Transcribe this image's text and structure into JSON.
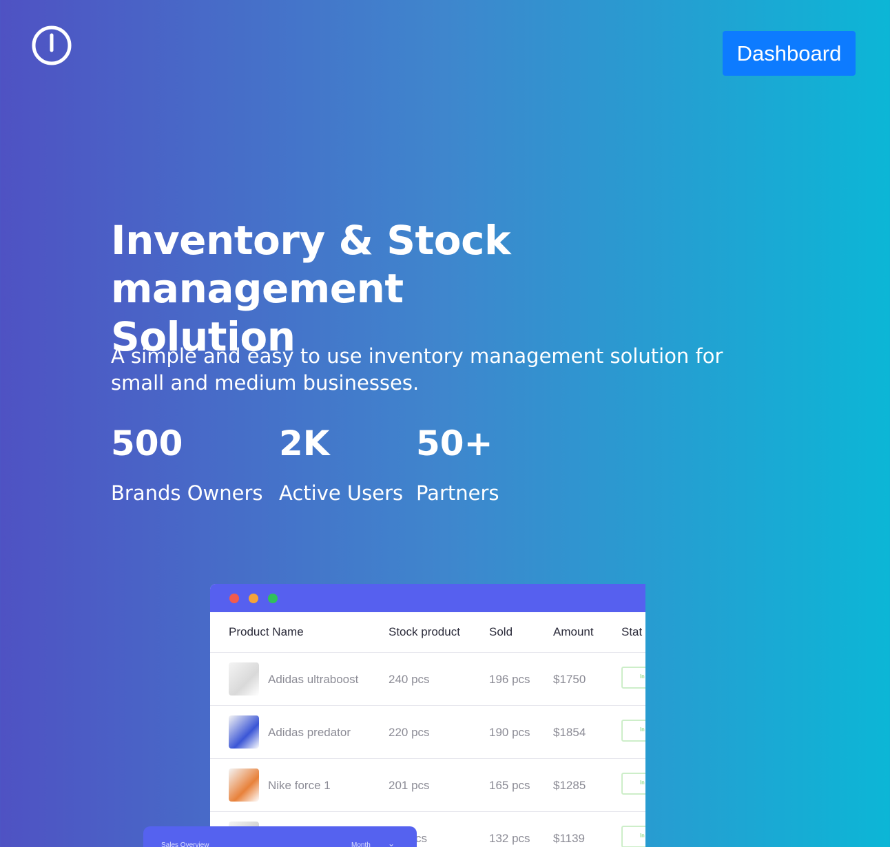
{
  "header": {
    "logo_icon": "power-icon",
    "dashboard_label": "Dashboard"
  },
  "hero": {
    "title_line1": "Inventory & Stock management",
    "title_line2": "Solution",
    "subtitle_line1": "A simple and easy to use inventory management solution for",
    "subtitle_line2": "small and medium businesses."
  },
  "stats": [
    {
      "value": "500",
      "label": "Brands Owners"
    },
    {
      "value": "2K",
      "label": "Active Users"
    },
    {
      "value": "50+",
      "label": "Partners"
    }
  ],
  "mockup": {
    "window_dots": [
      "#f15b4d",
      "#f5a33a",
      "#30c05a"
    ],
    "columns": [
      "Product Name",
      "Stock product",
      "Sold",
      "Amount",
      "Stat"
    ],
    "rows": [
      {
        "name": "Adidas ultraboost",
        "stock": "240 pcs",
        "sold": "196 pcs",
        "amount": "$1750",
        "status": "In",
        "thumb_color": "#d9d9d9"
      },
      {
        "name": "Adidas predator",
        "stock": "220 pcs",
        "sold": "190 pcs",
        "amount": "$1854",
        "status": "In",
        "thumb_color": "#3b56d6"
      },
      {
        "name": "Nike force 1",
        "stock": "201 pcs",
        "sold": "165 pcs",
        "amount": "$1285",
        "status": "In",
        "thumb_color": "#e8813a"
      },
      {
        "name": "",
        "stock": "cs",
        "sold": "132 pcs",
        "amount": "$1139",
        "status": "In",
        "thumb_color": "#cfcfcf"
      }
    ],
    "overlay_card": {
      "title": "Sales Overview",
      "selector": "Month"
    }
  }
}
